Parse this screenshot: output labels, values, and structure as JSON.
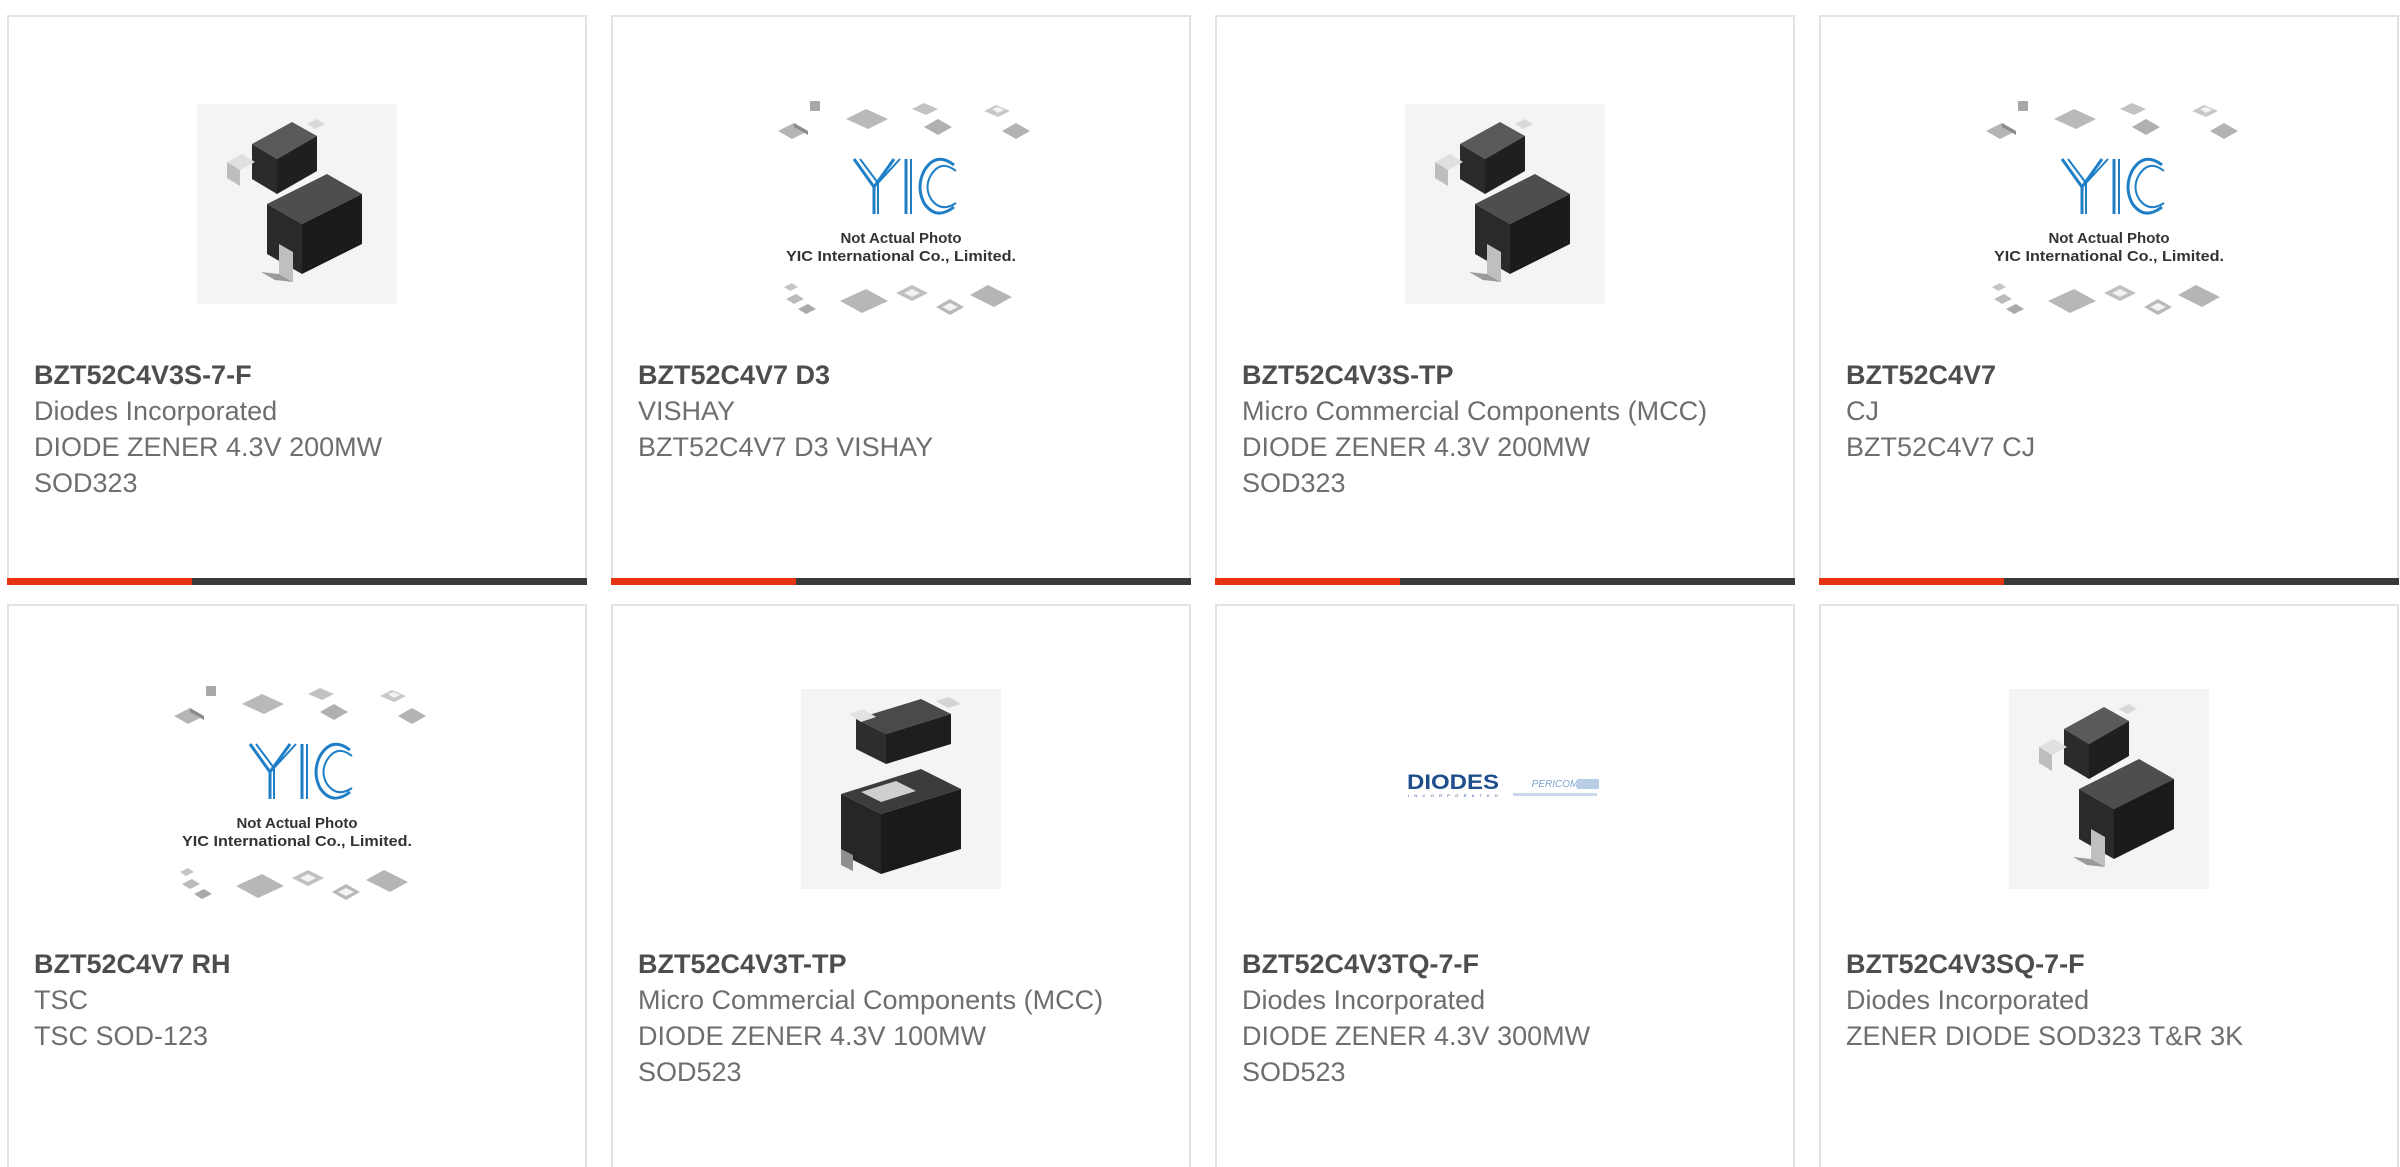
{
  "colors": {
    "accent": "#e63312",
    "bar_dark": "#3a3a3a",
    "border": "#e3e3e3",
    "part_text": "#4d4d4d",
    "desc_text": "#6e6e6e",
    "yic_blue": "#1e7fc6"
  },
  "placeholder_image": {
    "caption_line1": "Not Actual Photo",
    "caption_line2": "YIC International Co., Limited.",
    "logo_text": "YIC"
  },
  "diodes_logo": {
    "brand": "DIODES",
    "brand_sub": "INCORPORATED",
    "partner": "PERICOM"
  },
  "products": [
    {
      "part": "BZT52C4V3S-7-F",
      "manufacturer": "Diodes Incorporated",
      "desc1": "DIODE ZENER 4.3V 200MW",
      "desc2": "SOD323",
      "image": "sod323-package-photo"
    },
    {
      "part": "BZT52C4V7 D3",
      "manufacturer": "VISHAY",
      "desc1": "BZT52C4V7 D3 VISHAY",
      "desc2": "",
      "image": "yic-placeholder"
    },
    {
      "part": "BZT52C4V3S-TP",
      "manufacturer": "Micro Commercial Components (MCC)",
      "desc1": "DIODE ZENER 4.3V 200MW",
      "desc2": "SOD323",
      "image": "sod323-package-photo"
    },
    {
      "part": "BZT52C4V7",
      "manufacturer": "CJ",
      "desc1": "BZT52C4V7 CJ",
      "desc2": "",
      "image": "yic-placeholder"
    },
    {
      "part": "BZT52C4V7 RH",
      "manufacturer": "TSC",
      "desc1": "TSC SOD-123",
      "desc2": "",
      "image": "yic-placeholder"
    },
    {
      "part": "BZT52C4V3T-TP",
      "manufacturer": "Micro Commercial Components (MCC)",
      "desc1": "DIODE ZENER 4.3V 100MW",
      "desc2": "SOD523",
      "image": "sod523-package-photo"
    },
    {
      "part": "BZT52C4V3TQ-7-F",
      "manufacturer": "Diodes Incorporated",
      "desc1": "DIODE ZENER 4.3V 300MW",
      "desc2": "SOD523",
      "image": "diodes-pericom-logo"
    },
    {
      "part": "BZT52C4V3SQ-7-F",
      "manufacturer": "Diodes Incorporated",
      "desc1": "ZENER DIODE SOD323 T&R 3K",
      "desc2": "",
      "image": "sod323-package-photo"
    }
  ]
}
